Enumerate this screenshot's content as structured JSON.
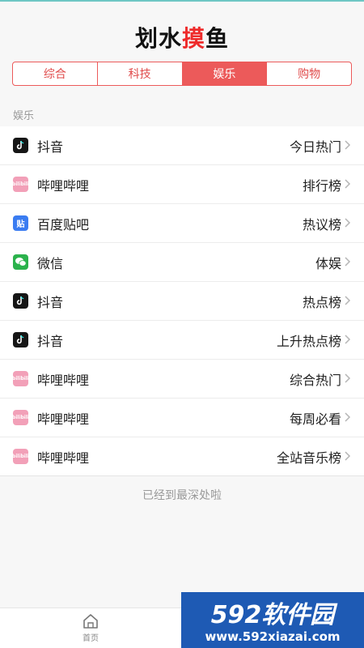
{
  "app": {
    "title_part1": "划水",
    "title_accent": "摸",
    "title_part2": "鱼"
  },
  "tabs": [
    {
      "label": "综合",
      "active": false
    },
    {
      "label": "科技",
      "active": false
    },
    {
      "label": "娱乐",
      "active": true
    },
    {
      "label": "购物",
      "active": false
    }
  ],
  "section": {
    "label": "娱乐"
  },
  "items": [
    {
      "icon": "tiktok-icon",
      "name": "抖音",
      "rank": "今日热门"
    },
    {
      "icon": "bilibili-icon",
      "name": "哔哩哔哩",
      "rank": "排行榜"
    },
    {
      "icon": "tieba-icon",
      "name": "百度贴吧",
      "rank": "热议榜"
    },
    {
      "icon": "wechat-icon",
      "name": "微信",
      "rank": "体娱"
    },
    {
      "icon": "tiktok-icon",
      "name": "抖音",
      "rank": "热点榜"
    },
    {
      "icon": "tiktok-icon",
      "name": "抖音",
      "rank": "上升热点榜"
    },
    {
      "icon": "bilibili-icon",
      "name": "哔哩哔哩",
      "rank": "综合热门"
    },
    {
      "icon": "bilibili-icon",
      "name": "哔哩哔哩",
      "rank": "每周必看"
    },
    {
      "icon": "bilibili-icon",
      "name": "哔哩哔哩",
      "rank": "全站音乐榜"
    }
  ],
  "icons_text": {
    "bili": "bilibili",
    "tieba": "贴"
  },
  "footer_note": "已经到最深处啦",
  "nav": {
    "home_label": "首页"
  },
  "watermark": {
    "line1": "592软件园",
    "line2": "www.592xiazai.com"
  },
  "colors": {
    "accent": "#ec5a5a",
    "title_accent": "#ee2b2b",
    "watermark_blue": "#1e5ab4"
  }
}
